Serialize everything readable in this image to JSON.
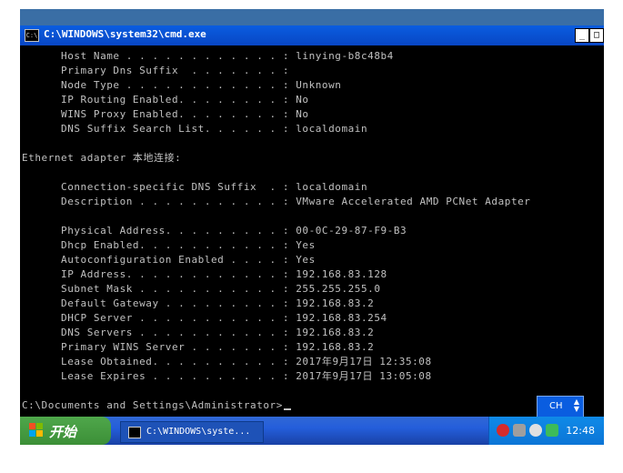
{
  "window": {
    "title": "C:\\WINDOWS\\system32\\cmd.exe",
    "minimize_glyph": "_",
    "maximize_glyph": "□"
  },
  "console": {
    "lines": [
      "      Host Name . . . . . . . . . . . . : linying-b8c48b4",
      "      Primary Dns Suffix  . . . . . . . :",
      "      Node Type . . . . . . . . . . . . : Unknown",
      "      IP Routing Enabled. . . . . . . . : No",
      "      WINS Proxy Enabled. . . . . . . . : No",
      "      DNS Suffix Search List. . . . . . : localdomain",
      "",
      "Ethernet adapter 本地连接:",
      "",
      "      Connection-specific DNS Suffix  . : localdomain",
      "      Description . . . . . . . . . . . : VMware Accelerated AMD PCNet Adapter",
      "",
      "      Physical Address. . . . . . . . . : 00-0C-29-87-F9-B3",
      "      Dhcp Enabled. . . . . . . . . . . : Yes",
      "      Autoconfiguration Enabled . . . . : Yes",
      "      IP Address. . . . . . . . . . . . : 192.168.83.128",
      "      Subnet Mask . . . . . . . . . . . : 255.255.255.0",
      "      Default Gateway . . . . . . . . . : 192.168.83.2",
      "      DHCP Server . . . . . . . . . . . : 192.168.83.254",
      "      DNS Servers . . . . . . . . . . . : 192.168.83.2",
      "      Primary WINS Server . . . . . . . : 192.168.83.2",
      "      Lease Obtained. . . . . . . . . . : 2017年9月17日 12:35:08",
      "      Lease Expires . . . . . . . . . . : 2017年9月17日 13:05:08",
      "",
      "C:\\Documents and Settings\\Administrator>"
    ]
  },
  "ime": {
    "label": "CH"
  },
  "taskbar": {
    "start_label": "开始",
    "task_label": "C:\\WINDOWS\\syste...",
    "clock": "12:48"
  },
  "colors": {
    "titlebar": "#0a5de0",
    "console_bg": "#000000",
    "console_text": "#c0c0c0",
    "start_green": "#3c8f37",
    "taskbar_blue": "#245edb",
    "tray_blue": "#0f8ae8"
  },
  "icons": {
    "title_icon": "cmd-icon",
    "task_icon": "cmd-icon",
    "tray": [
      "security-icon",
      "vmware-icon",
      "speaker-icon",
      "network-icon"
    ]
  }
}
